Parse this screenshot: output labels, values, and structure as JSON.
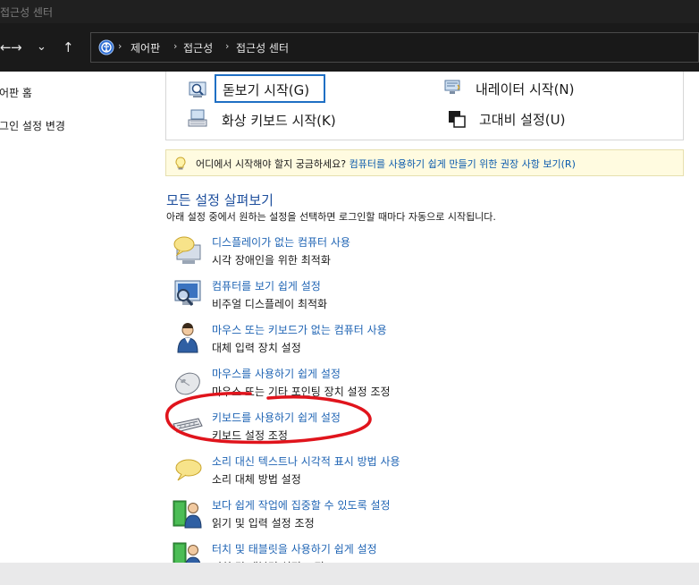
{
  "window": {
    "title": "접근성 센터"
  },
  "nav": {
    "back": "←",
    "forward": "→",
    "dropdown": "⌄",
    "up": "↑"
  },
  "address": {
    "crumbs": [
      "제어판",
      "접근성",
      "접근성 센터"
    ],
    "sep": "›"
  },
  "left_pane": {
    "items": [
      "제어판 홈",
      "로그인 설정 변경"
    ]
  },
  "quick": {
    "magnifier": "돋보기 시작(G)",
    "narrator": "내레이터 시작(N)",
    "keyboard": "화상 키보드 시작(K)",
    "contrast": "고대비 설정(U)"
  },
  "tip": {
    "text": "어디에서 시작해야 할지 궁금하세요?",
    "link": "컴퓨터를 사용하기 쉽게 만들기 위한 권장 사항 보기(R)"
  },
  "section": {
    "title": "모든 설정 살펴보기",
    "desc": "아래 설정 중에서 원하는 설정을 선택하면 로그인할 때마다 자동으로 시작됩니다."
  },
  "settings": [
    {
      "link": "디스플레이가 없는 컴퓨터 사용",
      "sub": "시각 장애인을 위한 최적화",
      "icon": "no-display-icon"
    },
    {
      "link": "컴퓨터를 보기 쉽게 설정",
      "sub": "비주얼 디스플레이 최적화",
      "icon": "magnifier-display-icon"
    },
    {
      "link": "마우스 또는 키보드가 없는 컴퓨터 사용",
      "sub": "대체 입력 장치 설정",
      "icon": "person-icon"
    },
    {
      "link": "마우스를 사용하기 쉽게 설정",
      "sub": "마우스 또는 기타 포인팅 장치 설정 조정",
      "icon": "mouse-icon"
    },
    {
      "link": "키보드를 사용하기 쉽게 설정",
      "sub": "키보드 설정 조정",
      "icon": "keyboard-icon"
    },
    {
      "link": "소리 대신 텍스트나 시각적 표시 방법 사용",
      "sub": "소리 대체 방법 설정",
      "icon": "speech-bubble-icon"
    },
    {
      "link": "보다 쉽게 작업에 집중할 수 있도록 설정",
      "sub": "읽기 및 입력 설정 조정",
      "icon": "person-book-icon"
    },
    {
      "link": "터치 및 태블릿을 사용하기 쉽게 설정",
      "sub": "터치 및 태블릿 설정 조정",
      "icon": "person-tablet-icon"
    }
  ],
  "colors": {
    "link": "#1f64b4",
    "annotation": "#e0141c",
    "focus": "#1f6fc4"
  }
}
